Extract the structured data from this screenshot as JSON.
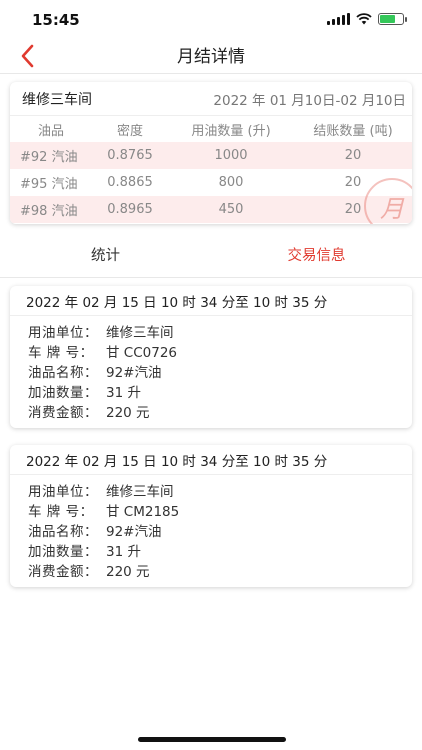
{
  "status_bar": {
    "time": "15:45"
  },
  "nav": {
    "title": "月结详情"
  },
  "summary": {
    "workshop": "维修三车间",
    "date_range": "2022 年 01 月10日-02 月10日",
    "columns": [
      "油品",
      "密度",
      "用油数量 (升)",
      "结账数量 (吨)"
    ],
    "rows": [
      {
        "product": "#92 汽油",
        "density": "0.8765",
        "fuel_qty": "1000",
        "settle_qty": "20"
      },
      {
        "product": "#95 汽油",
        "density": "0.8865",
        "fuel_qty": "800",
        "settle_qty": "20"
      },
      {
        "product": "#98 汽油",
        "density": "0.8965",
        "fuel_qty": "450",
        "settle_qty": "20"
      }
    ],
    "stamp_text": "月"
  },
  "tabs": [
    {
      "label": "统计",
      "active": false
    },
    {
      "label": "交易信息",
      "active": true
    }
  ],
  "records": [
    {
      "time": "2022 年 02 月 15 日 10 时 34 分至 10 时 35 分",
      "fields": [
        {
          "label": "用油单位：",
          "value": "维修三车间"
        },
        {
          "label": "车 牌 号：",
          "value": "甘 CC0726"
        },
        {
          "label": "油品名称：",
          "value": "92#汽油"
        },
        {
          "label": "加油数量：",
          "value": "31 升"
        },
        {
          "label": "消费金额：",
          "value": "220 元"
        }
      ]
    },
    {
      "time": "2022 年 02 月 15 日 10 时 34 分至 10 时 35 分",
      "fields": [
        {
          "label": "用油单位：",
          "value": "维修三车间"
        },
        {
          "label": "车 牌 号：",
          "value": "甘 CM2185"
        },
        {
          "label": "油品名称：",
          "value": "92#汽油"
        },
        {
          "label": "加油数量：",
          "value": "31 升"
        },
        {
          "label": "消费金额：",
          "value": "220 元"
        }
      ]
    }
  ],
  "colors": {
    "accent": "#e03a2f",
    "row_highlight": "#fdecec",
    "muted_text": "#888888"
  }
}
